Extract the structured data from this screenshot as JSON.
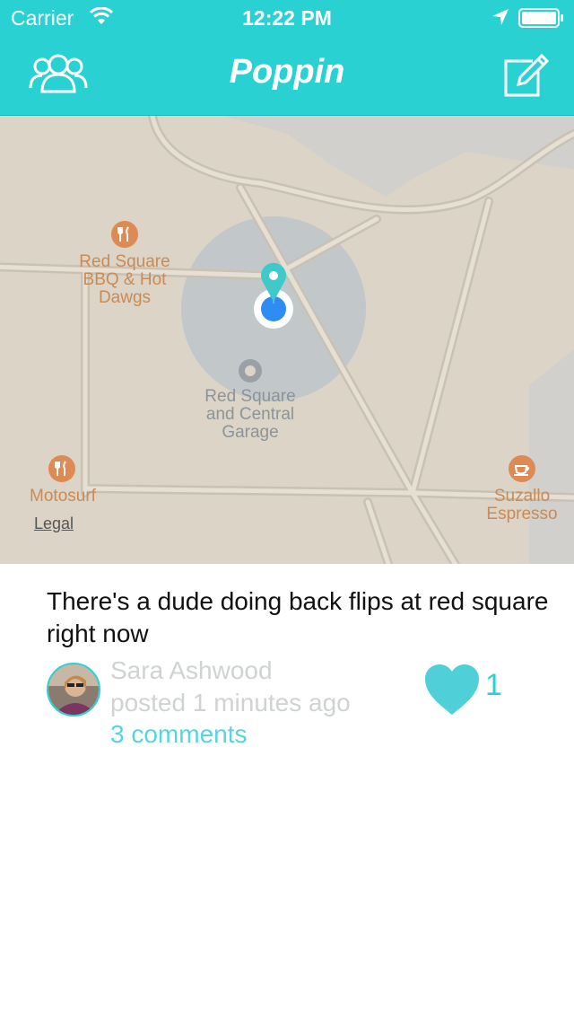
{
  "status_bar": {
    "carrier": "Carrier",
    "time": "12:22 PM"
  },
  "nav": {
    "title": "Poppin",
    "left_icon": "friends-icon",
    "right_icon": "compose-icon"
  },
  "map": {
    "pois": [
      {
        "name": "Red Square BBQ & Hot Dawgs",
        "lines": [
          "Red Square",
          "BBQ & Hot",
          "Dawgs"
        ],
        "icon": "restaurant-icon"
      },
      {
        "name": "Red Square and Central Garage",
        "lines": [
          "Red Square",
          "and Central",
          "Garage"
        ],
        "icon": "parking-icon"
      },
      {
        "name": "Motosurf",
        "lines": [
          "Motosurf"
        ],
        "icon": "restaurant-icon"
      },
      {
        "name": "Suzallo Espresso",
        "lines": [
          "Suzallo",
          "Espresso"
        ],
        "icon": "coffee-icon"
      }
    ],
    "legal": "Legal"
  },
  "post": {
    "text": "There's a dude doing back flips at red square right now",
    "author": "Sara Ashwood",
    "posted": "posted 1 minutes ago",
    "comments": "3 comments",
    "likes": "1"
  },
  "colors": {
    "accent": "#2ad1d2",
    "map_bg": "#dcd4c6",
    "poi": "#c98b55"
  }
}
